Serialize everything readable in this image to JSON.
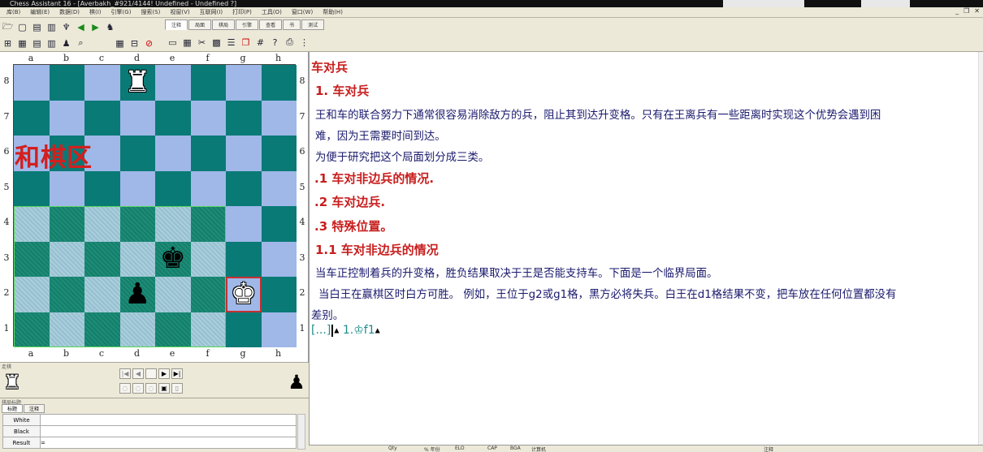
{
  "window": {
    "title": "Chess Assistant 16 - [Averbakh_#921/4144! Undefined - Undefined ?]"
  },
  "menu": [
    "库(B)",
    "编辑(E)",
    "数据(D)",
    "棋(I)",
    "引擎(G)",
    "搜索(S)",
    "视窗(V)",
    "互联网(I)",
    "打印(P)",
    "工具(O)",
    "窗口(W)",
    "帮助(H)"
  ],
  "tabs": [
    "注释",
    "局面",
    "棋局",
    "引擎",
    "查看",
    "书",
    "测试"
  ],
  "board": {
    "files": [
      "a",
      "b",
      "c",
      "d",
      "e",
      "f",
      "g",
      "h"
    ],
    "ranks": [
      "8",
      "7",
      "6",
      "5",
      "4",
      "3",
      "2",
      "1"
    ],
    "zone_label": "和棋区",
    "pieces": [
      {
        "square": "d8",
        "glyph": "♜",
        "color": "white",
        "name": "white-rook"
      },
      {
        "square": "e3",
        "glyph": "♚",
        "color": "black",
        "name": "black-king"
      },
      {
        "square": "d2",
        "glyph": "♟",
        "color": "black",
        "name": "black-pawn"
      },
      {
        "square": "g2",
        "glyph": "♚",
        "color": "white",
        "name": "white-king"
      }
    ],
    "highlight": "g2",
    "colors": {
      "light": "#9fb8e8",
      "dark": "#0a7a76",
      "zone_outline": "#59d45a"
    }
  },
  "nav": {
    "caption": "走棋",
    "white_side": "♜",
    "black_side": "♟",
    "buttons": [
      "|◀",
      "◀",
      "",
      "▶",
      "▶|"
    ]
  },
  "info": {
    "caption": "棋局标题",
    "tabs": [
      "标题",
      "注释"
    ],
    "rows": [
      {
        "key": "White",
        "value": ""
      },
      {
        "key": "Black",
        "value": ""
      },
      {
        "key": "Result",
        "value": "="
      }
    ]
  },
  "notation": {
    "title": "车对兵",
    "section1": "1. 车对兵",
    "para1a": "王和车的联合努力下通常很容易消除敌方的兵，阻止其到达升变格。只有在王离兵有一些距离时实现这个优势会遇到困",
    "para1b": "难，因为王需要时间到达。",
    "para2": "为便于研究把这个局面划分成三类。",
    "item1": ".1 车对非边兵的情况.",
    "item2": ".2 车对边兵.",
    "item3": ".3 特殊位置。",
    "section11": "1.1 车对非边兵的情况",
    "para3": "当车正控制着兵的升变格，胜负结果取决于王是否能支持车。下面是一个临界局面。",
    "para4a": "当白王在赢棋区时白方可胜。 例如，王位于g2或g1格，黑方必将失兵。白王在d1格结果不变，把车放在任何位置都没有",
    "para4b": "差别。",
    "move_bracket": "[...]",
    "move": "1.♔f1"
  },
  "gamelist": {
    "columns": [
      "Qty",
      "% 年份",
      "ELO",
      "CAP",
      "BGA",
      "计算机",
      "注释"
    ]
  }
}
